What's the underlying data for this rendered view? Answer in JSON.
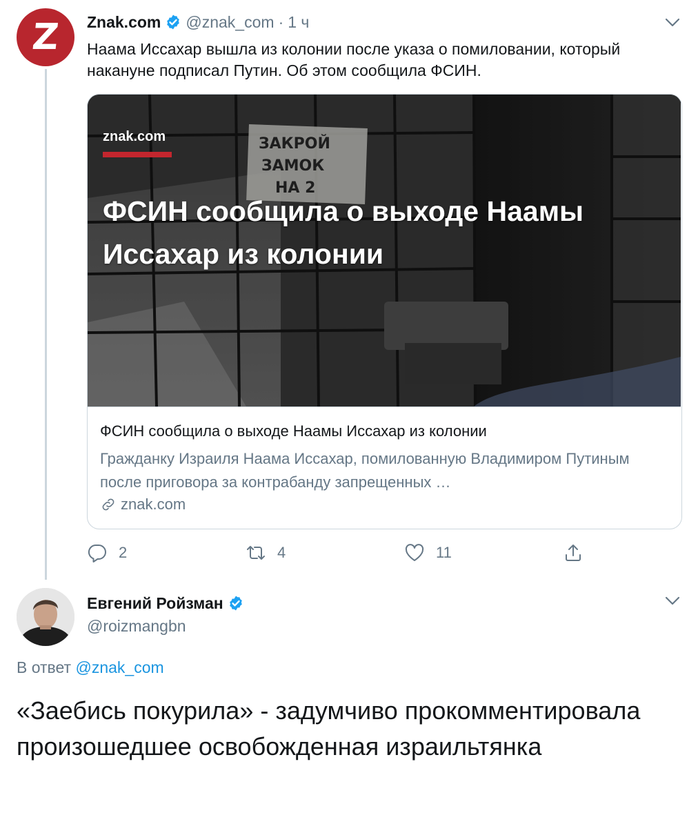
{
  "tweet1": {
    "author_name": "Znak.com",
    "handle": "@znak_com",
    "separator": "·",
    "time": "1 ч",
    "avatar_letter": "Z",
    "text": "Наама Иссахар вышла из колонии после указа о помиловании, который накануне подписал Путин. Об этом сообщила ФСИН.",
    "card": {
      "image_brand": "znak.com",
      "image_headline": "ФСИН сообщила о выходе Наамы Иссахар из колонии",
      "sign_text": [
        "ЗАКРОЙ",
        "ЗАМОК",
        "НА 2"
      ],
      "title": "ФСИН сообщила о выходе Наамы Иссахар из колонии",
      "description": "Гражданку Израиля Наама Иссахар, помилованную Владимиром Путиным после приговора за контрабанду запрещенных …",
      "domain": "znak.com"
    },
    "actions": {
      "replies": "2",
      "retweets": "4",
      "likes": "11"
    }
  },
  "tweet2": {
    "author_name": "Евгений Ройзман",
    "handle": "@roizmangbn",
    "reply_prefix": "В ответ",
    "reply_mention": "@znak_com",
    "text": "«Заебись покурила» - задумчиво прокомментировала произошедшее освобожденная израильтянка"
  },
  "colors": {
    "text_primary": "#14171a",
    "text_secondary": "#657786",
    "link": "#1b95e0",
    "verified": "#1da1f2",
    "border": "#ccd6dd",
    "znak_red": "#c3262e"
  },
  "icons": {
    "verified": "verified-badge-icon",
    "caret": "chevron-down-icon",
    "reply": "reply-icon",
    "retweet": "retweet-icon",
    "like": "heart-icon",
    "share": "share-icon",
    "link": "link-icon"
  }
}
